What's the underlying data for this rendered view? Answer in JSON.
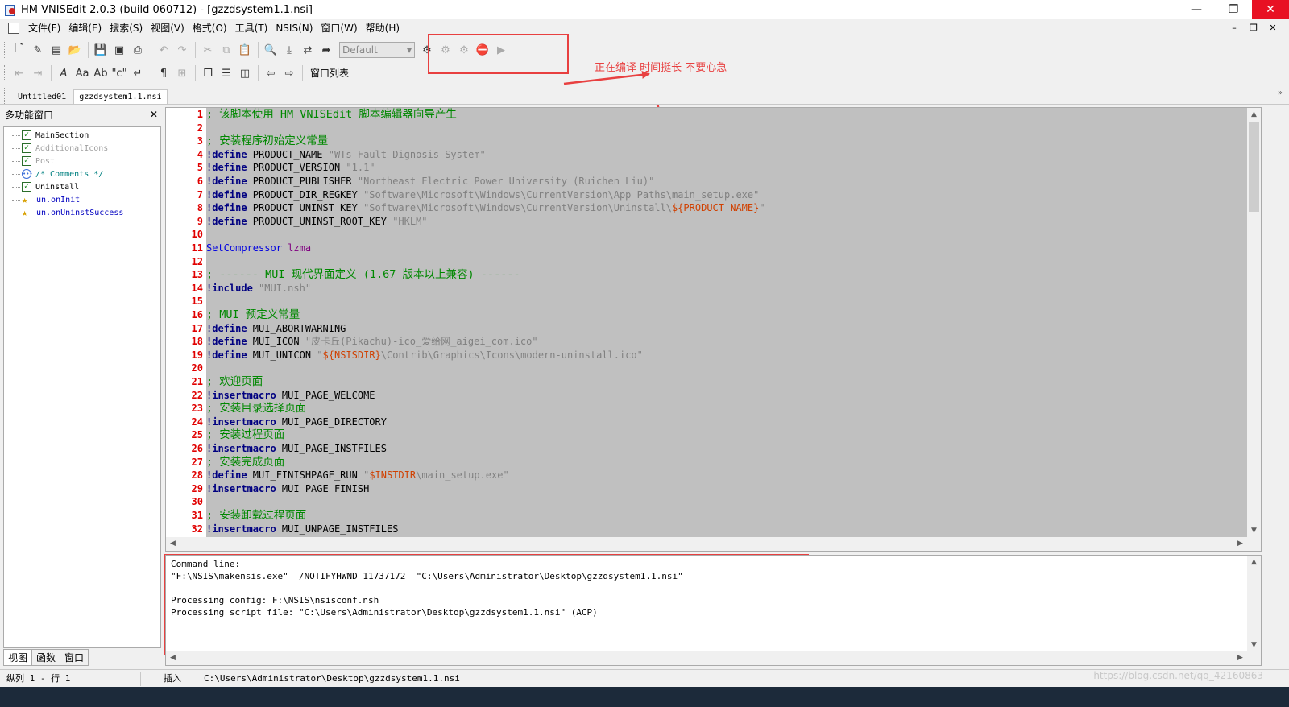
{
  "window": {
    "title": "HM VNISEdit 2.0.3 (build 060712) - [gzzdsystem1.1.nsi]",
    "minimize": "—",
    "restore": "❐",
    "close": "✕"
  },
  "menu": {
    "items": [
      "文件(F)",
      "编辑(E)",
      "搜索(S)",
      "视图(V)",
      "格式(O)",
      "工具(T)",
      "NSIS(N)",
      "窗口(W)",
      "帮助(H)"
    ],
    "mdi": [
      "–",
      "❐",
      "✕"
    ]
  },
  "toolbar": {
    "profile_combo": "Default",
    "window_list": "窗口列表"
  },
  "annotation": {
    "note": "正在编译 时间挺长 不要心急",
    "color": "#e84040"
  },
  "tabs": [
    "Untitled01",
    "gzzdsystem1.1.nsi"
  ],
  "tab_scroll": "»",
  "left_panel": {
    "title": "多功能窗口",
    "close": "✕",
    "tree": [
      {
        "label": "MainSection",
        "icon": "checkbox",
        "color": "#000000"
      },
      {
        "label": "AdditionalIcons",
        "icon": "checkbox",
        "color": "#a0a0a0"
      },
      {
        "label": "Post",
        "icon": "checkbox",
        "color": "#a0a0a0"
      },
      {
        "label": "/* Comments */",
        "icon": "comment",
        "color": "#008080"
      },
      {
        "label": "Uninstall",
        "icon": "checkbox",
        "color": "#000000"
      },
      {
        "label": "un.onInit",
        "icon": "function",
        "color": "#0000c0"
      },
      {
        "label": "un.onUninstSuccess",
        "icon": "function",
        "color": "#0000c0"
      }
    ],
    "bottom_tabs": [
      "视图",
      "函数",
      "窗口"
    ]
  },
  "editor": {
    "lines": [
      [
        {
          "t": "; 该脚本使用 HM VNISEdit 脚本编辑器向导产生",
          "c": "cmt"
        }
      ],
      [],
      [
        {
          "t": "; 安装程序初始定义常量",
          "c": "cmt"
        }
      ],
      [
        {
          "t": "!define ",
          "c": "kw"
        },
        {
          "t": "PRODUCT_NAME ",
          "c": "name"
        },
        {
          "t": "\"WTs Fault Dignosis System\"",
          "c": "str"
        }
      ],
      [
        {
          "t": "!define ",
          "c": "kw"
        },
        {
          "t": "PRODUCT_VERSION ",
          "c": "name"
        },
        {
          "t": "\"1.1\"",
          "c": "str"
        }
      ],
      [
        {
          "t": "!define ",
          "c": "kw"
        },
        {
          "t": "PRODUCT_PUBLISHER ",
          "c": "name"
        },
        {
          "t": "\"Northeast Electric Power University (Ruichen Liu)\"",
          "c": "str"
        }
      ],
      [
        {
          "t": "!define ",
          "c": "kw"
        },
        {
          "t": "PRODUCT_DIR_REGKEY ",
          "c": "name"
        },
        {
          "t": "\"Software\\Microsoft\\Windows\\CurrentVersion\\App Paths\\main_setup.exe\"",
          "c": "str"
        }
      ],
      [
        {
          "t": "!define ",
          "c": "kw"
        },
        {
          "t": "PRODUCT_UNINST_KEY ",
          "c": "name"
        },
        {
          "t": "\"Software\\Microsoft\\Windows\\CurrentVersion\\Uninstall\\",
          "c": "str"
        },
        {
          "t": "${PRODUCT_NAME}",
          "c": "var"
        },
        {
          "t": "\"",
          "c": "str"
        }
      ],
      [
        {
          "t": "!define ",
          "c": "kw"
        },
        {
          "t": "PRODUCT_UNINST_ROOT_KEY ",
          "c": "name"
        },
        {
          "t": "\"HKLM\"",
          "c": "str"
        }
      ],
      [],
      [
        {
          "t": "SetCompressor ",
          "c": "fn"
        },
        {
          "t": "lzma",
          "c": "arg"
        }
      ],
      [],
      [
        {
          "t": "; ------ MUI 现代界面定义 (1.67 版本以上兼容) ------",
          "c": "cmt"
        }
      ],
      [
        {
          "t": "!include ",
          "c": "kw"
        },
        {
          "t": "\"MUI.nsh\"",
          "c": "str"
        }
      ],
      [],
      [
        {
          "t": "; MUI 预定义常量",
          "c": "cmt"
        }
      ],
      [
        {
          "t": "!define ",
          "c": "kw"
        },
        {
          "t": "MUI_ABORTWARNING",
          "c": "name"
        }
      ],
      [
        {
          "t": "!define ",
          "c": "kw"
        },
        {
          "t": "MUI_ICON ",
          "c": "name"
        },
        {
          "t": "\"皮卡丘(Pikachu)-ico_爱给网_aigei_com.ico\"",
          "c": "str"
        }
      ],
      [
        {
          "t": "!define ",
          "c": "kw"
        },
        {
          "t": "MUI_UNICON ",
          "c": "name"
        },
        {
          "t": "\"",
          "c": "str"
        },
        {
          "t": "${NSISDIR}",
          "c": "var"
        },
        {
          "t": "\\Contrib\\Graphics\\Icons\\modern-uninstall.ico\"",
          "c": "str"
        }
      ],
      [],
      [
        {
          "t": "; 欢迎页面",
          "c": "cmt"
        }
      ],
      [
        {
          "t": "!insertmacro ",
          "c": "kw"
        },
        {
          "t": "MUI_PAGE_WELCOME",
          "c": "name"
        }
      ],
      [
        {
          "t": "; 安装目录选择页面",
          "c": "cmt"
        }
      ],
      [
        {
          "t": "!insertmacro ",
          "c": "kw"
        },
        {
          "t": "MUI_PAGE_DIRECTORY",
          "c": "name"
        }
      ],
      [
        {
          "t": "; 安装过程页面",
          "c": "cmt"
        }
      ],
      [
        {
          "t": "!insertmacro ",
          "c": "kw"
        },
        {
          "t": "MUI_PAGE_INSTFILES",
          "c": "name"
        }
      ],
      [
        {
          "t": "; 安装完成页面",
          "c": "cmt"
        }
      ],
      [
        {
          "t": "!define ",
          "c": "kw"
        },
        {
          "t": "MUI_FINISHPAGE_RUN ",
          "c": "name"
        },
        {
          "t": "\"",
          "c": "str"
        },
        {
          "t": "$INSTDIR",
          "c": "var"
        },
        {
          "t": "\\main_setup.exe\"",
          "c": "str"
        }
      ],
      [
        {
          "t": "!insertmacro ",
          "c": "kw"
        },
        {
          "t": "MUI_PAGE_FINISH",
          "c": "name"
        }
      ],
      [],
      [
        {
          "t": "; 安装卸载过程页面",
          "c": "cmt"
        }
      ],
      [
        {
          "t": "!insertmacro ",
          "c": "kw"
        },
        {
          "t": "MUI_UNPAGE_INSTFILES",
          "c": "name"
        }
      ]
    ],
    "colors": {
      "cmt": "#008800",
      "kw": "#000080",
      "name": "#000000",
      "str": "#808080",
      "var": "#d04000",
      "fn": "#0000e0",
      "arg": "#800080"
    }
  },
  "output": {
    "lines": [
      "Command line:",
      "\"F:\\NSIS\\makensis.exe\"  /NOTIFYHWND 11737172  \"C:\\Users\\Administrator\\Desktop\\gzzdsystem1.1.nsi\"",
      "",
      "Processing config: F:\\NSIS\\nsisconf.nsh",
      "Processing script file: \"C:\\Users\\Administrator\\Desktop\\gzzdsystem1.1.nsi\" (ACP)"
    ]
  },
  "statusbar": {
    "position": "纵列 1 - 行 1",
    "mode": "插入",
    "path": "C:\\Users\\Administrator\\Desktop\\gzzdsystem1.1.nsi",
    "watermark": "https://blog.csdn.net/qq_42160863"
  }
}
